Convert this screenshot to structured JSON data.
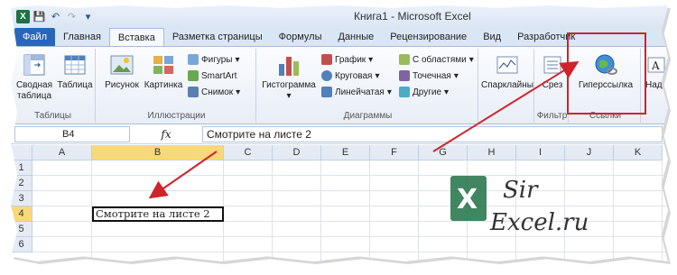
{
  "titlebar": {
    "title": "Книга1 - Microsoft Excel"
  },
  "tabs": [
    {
      "label": "Файл"
    },
    {
      "label": "Главная"
    },
    {
      "label": "Вставка"
    },
    {
      "label": "Разметка страницы"
    },
    {
      "label": "Формулы"
    },
    {
      "label": "Данные"
    },
    {
      "label": "Рецензирование"
    },
    {
      "label": "Вид"
    },
    {
      "label": "Разработчик"
    }
  ],
  "ribbon": {
    "tables": {
      "pivot_line1": "Сводная",
      "pivot_line2": "таблица",
      "table": "Таблица",
      "group": "Таблицы"
    },
    "illustrations": {
      "picture": "Рисунок",
      "clipart": "Картинка",
      "shapes": "Фигуры",
      "smartart": "SmartArt",
      "screenshot": "Снимок",
      "group": "Иллюстрации"
    },
    "charts": {
      "histogram": "Гистограмма",
      "graph": "График",
      "pie": "Круговая",
      "line": "Линейчатая",
      "area": "С областями",
      "scatter": "Точечная",
      "other": "Другие",
      "group": "Диаграммы"
    },
    "sparklines": {
      "label": "Спарклайны"
    },
    "filter": {
      "slicer": "Срез",
      "group": "Фильтр"
    },
    "links": {
      "hyperlink": "Гиперссылка",
      "group": "Ссылки"
    },
    "text": {
      "label": "Надп"
    }
  },
  "formula_bar": {
    "namebox": "B4",
    "fx": "fx",
    "formula": "Смотрите на листе 2"
  },
  "grid": {
    "columns": [
      "A",
      "B",
      "C",
      "D",
      "E",
      "F",
      "G",
      "H",
      "I",
      "J",
      "K"
    ],
    "rows": [
      "1",
      "2",
      "3",
      "4",
      "5",
      "6"
    ],
    "selected_col": "B",
    "selected_row": "4",
    "cell_b4": "Смотрите на листе 2"
  },
  "watermark": {
    "text1": "Sir",
    "text2": "Excel.ru"
  },
  "colors": {
    "accent_red": "#d0232a",
    "excel_green": "#1e7145",
    "file_tab": "#2a66b8"
  }
}
